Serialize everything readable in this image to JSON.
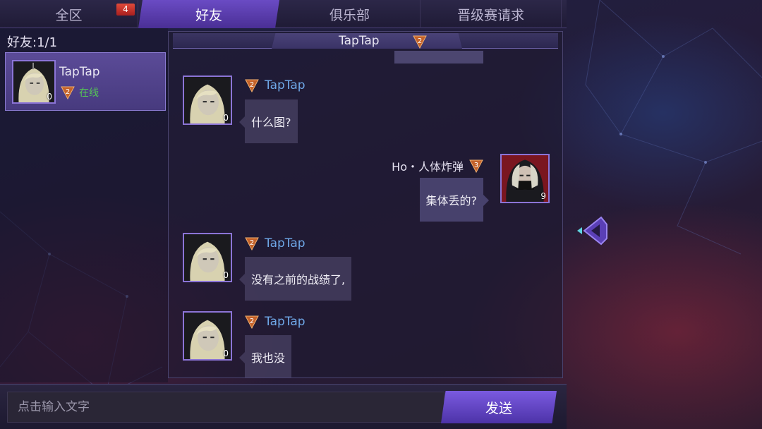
{
  "colors": {
    "accent": "#5b3fb8",
    "name_blue": "#6fa8e8",
    "online_green": "#55c655",
    "badge_red": "#d13a2c"
  },
  "tabs": [
    {
      "label": "全区",
      "badge": "4"
    },
    {
      "label": "好友",
      "active": true
    },
    {
      "label": "俱乐部"
    },
    {
      "label": "晋级赛请求"
    }
  ],
  "friends": {
    "count_label": "好友:1/1",
    "items": [
      {
        "name": "TapTap",
        "rank": "2",
        "status": "在线",
        "avatar_level": "0"
      }
    ]
  },
  "chat": {
    "title": "TapTap",
    "title_rank": "2",
    "messages": [
      {
        "sender": "TapTap",
        "rank": "2",
        "avatar_level": "0",
        "text": "什么图?",
        "side": "left",
        "icon": "pale-hair-avatar"
      },
      {
        "sender": "Ho・人体炸弹",
        "rank": "3",
        "avatar_level": "9",
        "text": "集体丢的?",
        "side": "right",
        "icon": "masked-hood-avatar"
      },
      {
        "sender": "TapTap",
        "rank": "2",
        "avatar_level": "0",
        "text": "没有之前的战绩了,",
        "side": "left",
        "icon": "pale-hair-avatar"
      },
      {
        "sender": "TapTap",
        "rank": "2",
        "avatar_level": "0",
        "text": "我也没",
        "side": "left",
        "icon": "pale-hair-avatar"
      }
    ]
  },
  "input": {
    "placeholder": "点击输入文字",
    "send_label": "发送"
  }
}
